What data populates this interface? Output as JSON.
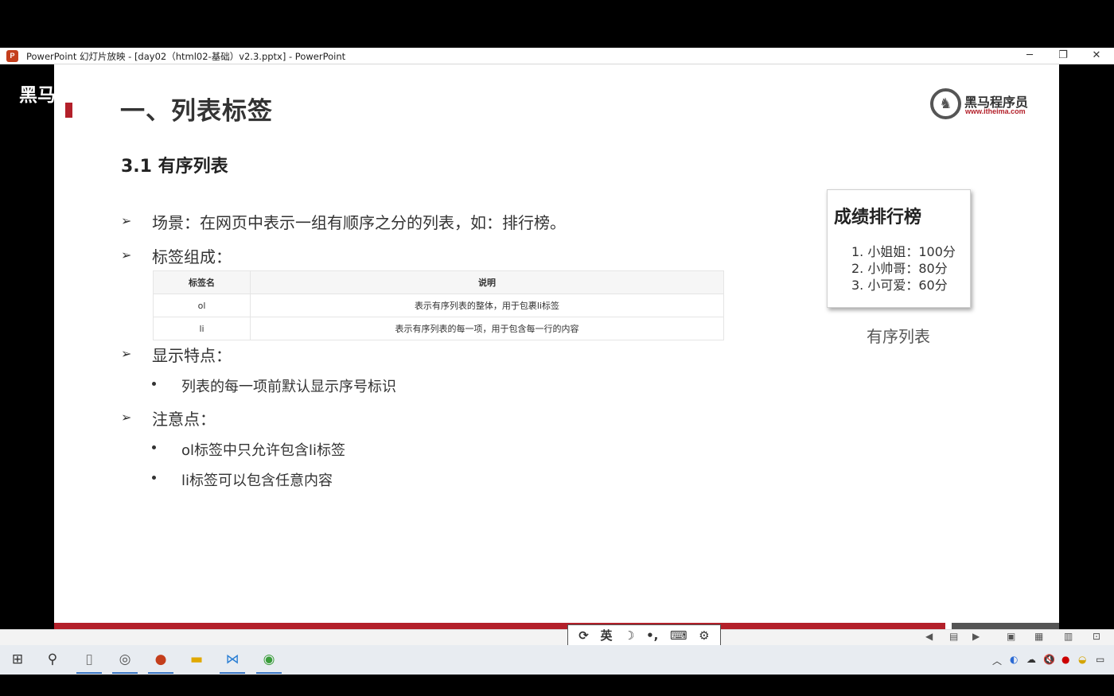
{
  "window": {
    "title": "PowerPoint 幻灯片放映 - [day02（html02-基础）v2.3.pptx] - PowerPoint",
    "app_icon_letter": "P",
    "minimize": "─",
    "restore": "❐",
    "close": "✕"
  },
  "watermark": "黑马",
  "slide": {
    "title": "一、列表标签",
    "logo": {
      "name": "黑马程序员",
      "url": "www.itheima.com"
    },
    "section": "3.1 有序列表",
    "bullets": [
      {
        "text": "场景：在网页中表示一组有顺序之分的列表，如：排行榜。"
      },
      {
        "text": "标签组成："
      },
      {
        "text": "显示特点："
      },
      {
        "text": "注意点："
      }
    ],
    "table": {
      "headers": [
        "标签名",
        "说明"
      ],
      "rows": [
        [
          "ol",
          "表示有序列表的整体，用于包裹li标签"
        ],
        [
          "li",
          "表示有序列表的每一项，用于包含每一行的内容"
        ]
      ]
    },
    "display_points": [
      "列表的每一项前默认显示序号标识"
    ],
    "notes": [
      "ol标签中只允许包含li标签",
      "li标签可以包含任意内容"
    ],
    "rank_box": {
      "title": "成绩排行榜",
      "items": [
        "1. 小姐姐：100分",
        "2. 小帅哥：80分",
        "3. 小可爱：60分"
      ]
    },
    "caption": "有序列表"
  },
  "ime": [
    "⟳",
    "英",
    "☽",
    "•,",
    "⌨",
    "⚙"
  ],
  "taskbar": {
    "items": [
      "windows-start",
      "search",
      "file-explorer",
      "recorder",
      "powerpoint",
      "folder",
      "vscode",
      "chrome"
    ]
  }
}
